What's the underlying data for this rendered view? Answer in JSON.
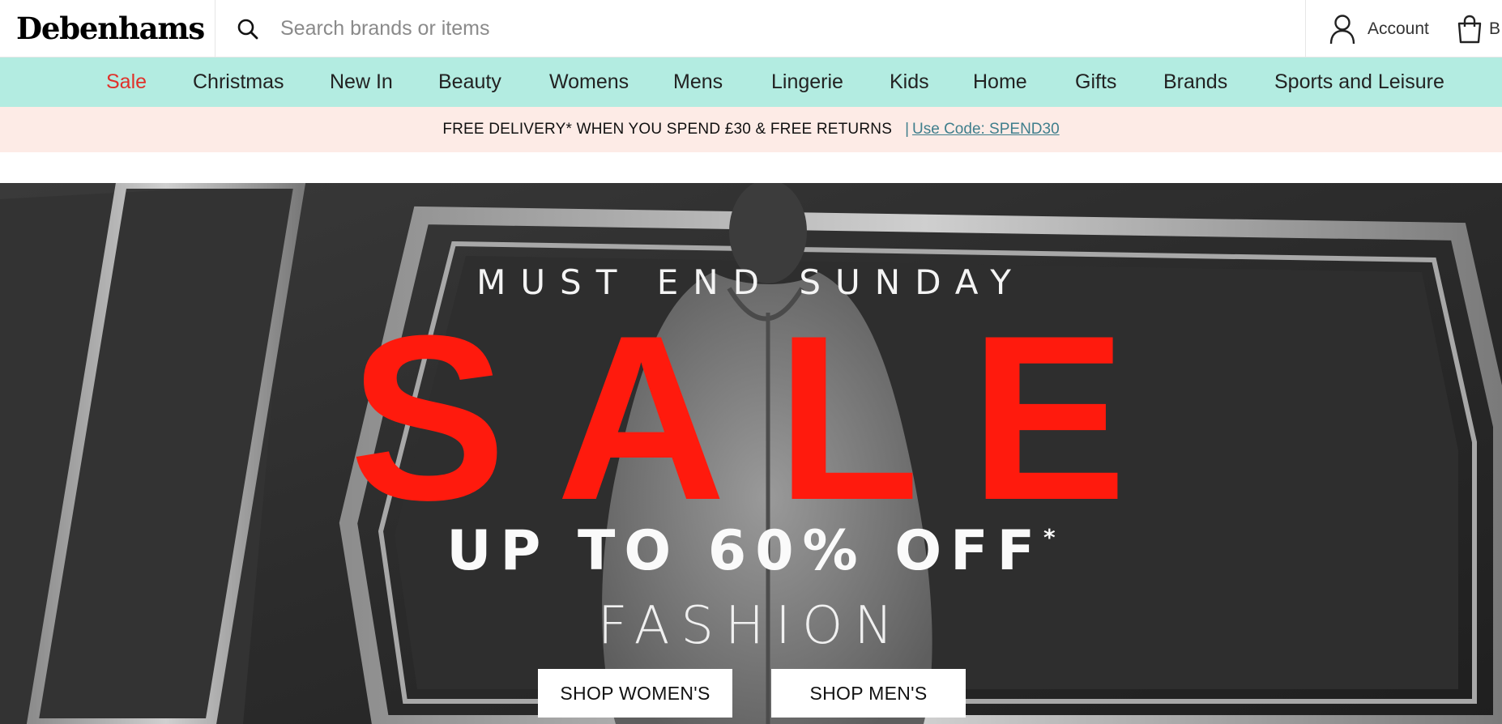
{
  "brand": {
    "name": "Debenhams"
  },
  "search": {
    "placeholder": "Search brands or items",
    "icon": "search-icon"
  },
  "account": {
    "label": "Account",
    "icon": "user-icon"
  },
  "bag": {
    "label": "B",
    "icon": "bag-icon"
  },
  "nav": {
    "items": [
      {
        "label": "Sale",
        "highlight": true
      },
      {
        "label": "Christmas"
      },
      {
        "label": "New In"
      },
      {
        "label": "Beauty"
      },
      {
        "label": "Womens"
      },
      {
        "label": "Mens"
      },
      {
        "label": "Lingerie"
      },
      {
        "label": "Kids"
      },
      {
        "label": "Home"
      },
      {
        "label": "Gifts"
      },
      {
        "label": "Brands"
      },
      {
        "label": "Sports and Leisure"
      }
    ]
  },
  "promo": {
    "text": "FREE DELIVERY* WHEN YOU SPEND £30 & FREE RETURNS",
    "separator": "|",
    "code_link": "Use Code: SPEND30"
  },
  "hero": {
    "eyebrow": "MUST END SUNDAY",
    "headline": "SALE",
    "discount": "UP TO 60% OFF",
    "discount_mark": "*",
    "category": "FASHION",
    "buttons": {
      "women": "SHOP WOMEN'S",
      "men": "SHOP MEN'S"
    }
  },
  "colors": {
    "nav_bg": "#b3ece1",
    "promo_bg": "#fdebe6",
    "sale_red": "#e0312b",
    "headline_red": "#ff1a0d",
    "link_teal": "#3f7e8c"
  }
}
